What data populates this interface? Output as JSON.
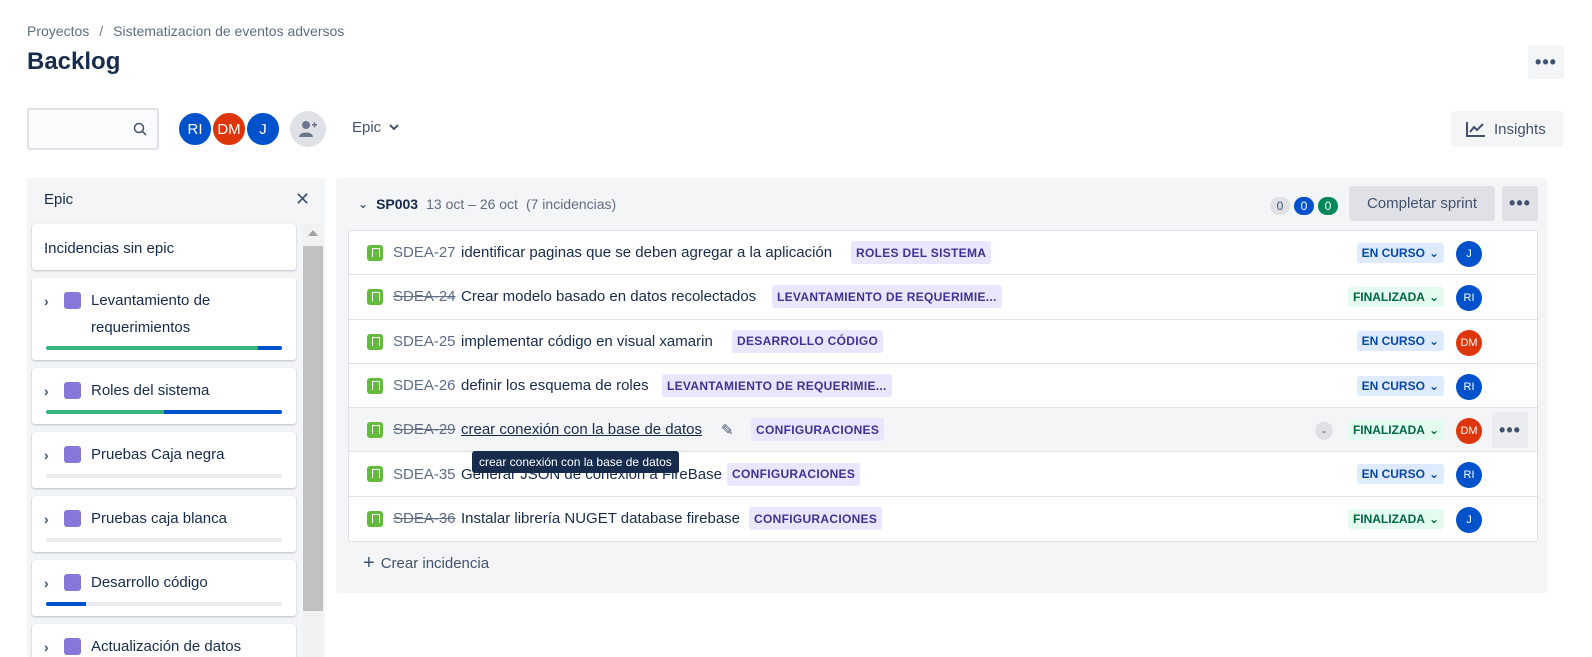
{
  "breadcrumb": [
    "Proyectos",
    "/",
    "Sistematizacion de eventos adversos"
  ],
  "page_title": "Backlog",
  "more_label": "•••",
  "avatars": [
    "RI",
    "DM",
    "J"
  ],
  "epic_filter": "Epic",
  "insights_label": "Insights",
  "epic_panel": {
    "title": "Epic",
    "close": "✕",
    "no_epic": "Incidencias sin epic",
    "epics": [
      {
        "name_l1": "Levantamiento de",
        "name_l2": "requerimientos",
        "done": 0.9,
        "in_progress": 0.1
      },
      {
        "name_l1": "Roles del sistema",
        "done": 0.5,
        "in_progress": 0.5
      },
      {
        "name_l1": "Pruebas Caja negra",
        "done": 0,
        "in_progress": 0
      },
      {
        "name_l1": "Pruebas caja blanca",
        "done": 0,
        "in_progress": 0
      },
      {
        "name_l1": "Desarrollo código",
        "done": 0,
        "in_progress": 0.17
      },
      {
        "name_l1": "Actualización de datos"
      }
    ]
  },
  "sprint": {
    "name": "SP003",
    "dates": "13 oct – 26 oct",
    "count": "(7 incidencias)",
    "counts": [
      "0",
      "0",
      "0"
    ],
    "complete_label": "Completar sprint",
    "issues": [
      {
        "key": "SDEA-27",
        "summary": "identificar paginas que se deben agregar a la aplicación",
        "label": "ROLES DEL SISTEMA",
        "status": "EN CURSO",
        "assignee": "J"
      },
      {
        "key": "SDEA-24",
        "summary": "Crear modelo basado en datos recolectados",
        "label": "LEVANTAMIENTO DE REQUERIMIE...",
        "status": "FINALIZADA",
        "assignee": "RI"
      },
      {
        "key": "SDEA-25",
        "summary": "implementar código en visual xamarin",
        "label": "DESARROLLO CÓDIGO",
        "status": "EN CURSO",
        "assignee": "DM"
      },
      {
        "key": "SDEA-26",
        "summary": "definir los esquema de roles",
        "label": "LEVANTAMIENTO DE REQUERIMIE...",
        "status": "EN CURSO",
        "assignee": "RI"
      },
      {
        "key": "SDEA-29",
        "summary": "crear conexión con la base de datos",
        "label": "CONFIGURACIONES",
        "status": "FINALIZADA",
        "assignee": "DM",
        "estimate": "-"
      },
      {
        "key": "SDEA-35",
        "summary": "Generar JSON de conexión a FireBase",
        "label": "CONFIGURACIONES",
        "status": "EN CURSO",
        "assignee": "RI"
      },
      {
        "key": "SDEA-36",
        "summary": "Instalar librería NUGET database firebase",
        "label": "CONFIGURACIONES",
        "status": "FINALIZADA",
        "assignee": "J"
      }
    ],
    "tooltip": "crear conexión con la base de datos",
    "create_issue": "Crear incidencia"
  }
}
